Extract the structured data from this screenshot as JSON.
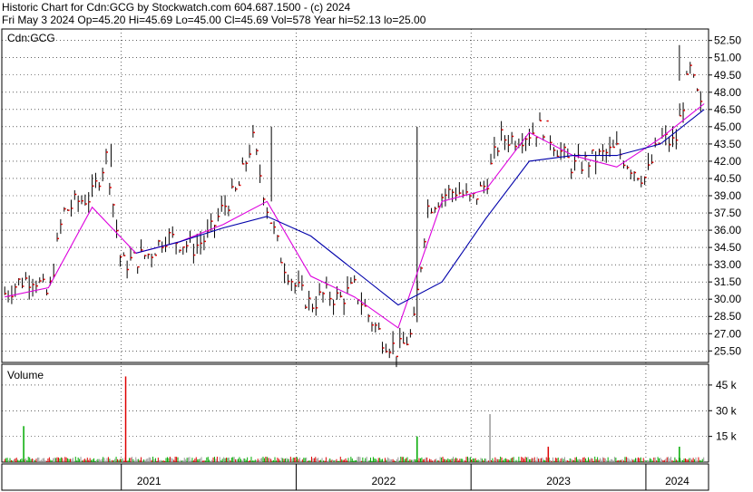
{
  "header": {
    "line1": "Historic Chart for Cdn:GCG by Stockwatch.com 604.687.1500 - (c) 2024",
    "line2": "Fri May  3 2024  Op=45.20  Hi=45.69  Lo=45.00  Cl=45.69  Vol=578  Year hi=52.13  lo=25.00"
  },
  "colors": {
    "background": "#ffffff",
    "price_bar": "#000000",
    "close_tick": "#dd0000",
    "ma_short": "#dd00dd",
    "ma_long": "#0000aa",
    "volume_up": "#00aa00",
    "volume_down": "#dd0000",
    "volume_neutral": "#999999",
    "grid": "#000000"
  },
  "chart_data": [
    {
      "type": "line",
      "title": "Cdn:GCG",
      "y_ticks": [
        "52.50",
        "51.00",
        "49.50",
        "48.00",
        "46.50",
        "45.00",
        "43.50",
        "42.00",
        "40.50",
        "39.00",
        "37.50",
        "36.00",
        "34.50",
        "33.00",
        "31.50",
        "30.00",
        "28.50",
        "27.00",
        "25.50"
      ],
      "ylim": [
        24.5,
        53.5
      ],
      "x_labels": [
        "2021",
        "2022",
        "2023",
        "2024"
      ],
      "grid": "dotted",
      "series": [
        {
          "kind": "price",
          "x": [
            "2020-05",
            "2020-06",
            "2020-07",
            "2020-08",
            "2020-09",
            "2020-10",
            "2020-11",
            "2020-12",
            "2021-01",
            "2021-02",
            "2021-03",
            "2021-04",
            "2021-05",
            "2021-06",
            "2021-07",
            "2021-08",
            "2021-09",
            "2021-10",
            "2021-11",
            "2021-12",
            "2022-01",
            "2022-02",
            "2022-03",
            "2022-04",
            "2022-05",
            "2022-06",
            "2022-07",
            "2022-08",
            "2022-09",
            "2022-10",
            "2022-11",
            "2022-12",
            "2023-01",
            "2023-02",
            "2023-03",
            "2023-04",
            "2023-05",
            "2023-06",
            "2023-07",
            "2023-08",
            "2023-09",
            "2023-10",
            "2023-11",
            "2023-12",
            "2024-01",
            "2024-02",
            "2024-03",
            "2024-04",
            "2024-05"
          ],
          "y": [
            30.5,
            31.5,
            32.0,
            30.2,
            37.5,
            38.5,
            39.0,
            42.5,
            33.0,
            33.5,
            34.0,
            35.5,
            35.0,
            34.5,
            35.5,
            38.0,
            39.5,
            44.0,
            38.0,
            33.5,
            31.0,
            29.5,
            30.5,
            30.0,
            31.0,
            28.5,
            26.5,
            25.5,
            27.0,
            38.0,
            39.0,
            39.5,
            38.5,
            40.0,
            44.0,
            44.0,
            44.5,
            45.0,
            43.0,
            41.5,
            42.0,
            42.5,
            43.0,
            41.5,
            40.5,
            44.0,
            43.5,
            50.0,
            45.5
          ]
        },
        {
          "kind": "ma_short",
          "x": [
            "2020-05",
            "2020-08",
            "2020-11",
            "2021-02",
            "2021-05",
            "2021-08",
            "2021-11",
            "2022-02",
            "2022-05",
            "2022-08",
            "2022-11",
            "2023-02",
            "2023-05",
            "2023-08",
            "2023-11",
            "2024-02",
            "2024-05"
          ],
          "y": [
            30.2,
            31.0,
            38.0,
            34.0,
            35.0,
            36.5,
            38.5,
            32.0,
            30.2,
            27.5,
            38.5,
            39.5,
            44.5,
            42.5,
            41.5,
            44.0,
            47.0
          ]
        },
        {
          "kind": "ma_long",
          "x": [
            "2021-02",
            "2021-05",
            "2021-08",
            "2021-11",
            "2022-02",
            "2022-05",
            "2022-08",
            "2022-11",
            "2023-02",
            "2023-05",
            "2023-08",
            "2023-11",
            "2024-02",
            "2024-05"
          ],
          "y": [
            34.0,
            35.0,
            36.2,
            37.2,
            35.5,
            32.5,
            29.5,
            31.5,
            37.0,
            42.0,
            42.5,
            42.5,
            43.5,
            46.5
          ]
        }
      ]
    },
    {
      "type": "bar",
      "title": "Volume",
      "y_ticks": [
        "45 k",
        "30 k",
        "15 k"
      ],
      "ylim": [
        0,
        55000
      ],
      "spikes": [
        {
          "x": "2020-06",
          "value": 21000,
          "color": "volume_up"
        },
        {
          "x": "2021-01",
          "value": 50000,
          "color": "volume_down"
        },
        {
          "x": "2022-09",
          "value": 15000,
          "color": "volume_up"
        },
        {
          "x": "2023-02",
          "value": 28000,
          "color": "volume_neutral"
        },
        {
          "x": "2023-06",
          "value": 9000,
          "color": "volume_down"
        },
        {
          "x": "2024-03",
          "value": 9000,
          "color": "volume_up"
        }
      ]
    }
  ]
}
